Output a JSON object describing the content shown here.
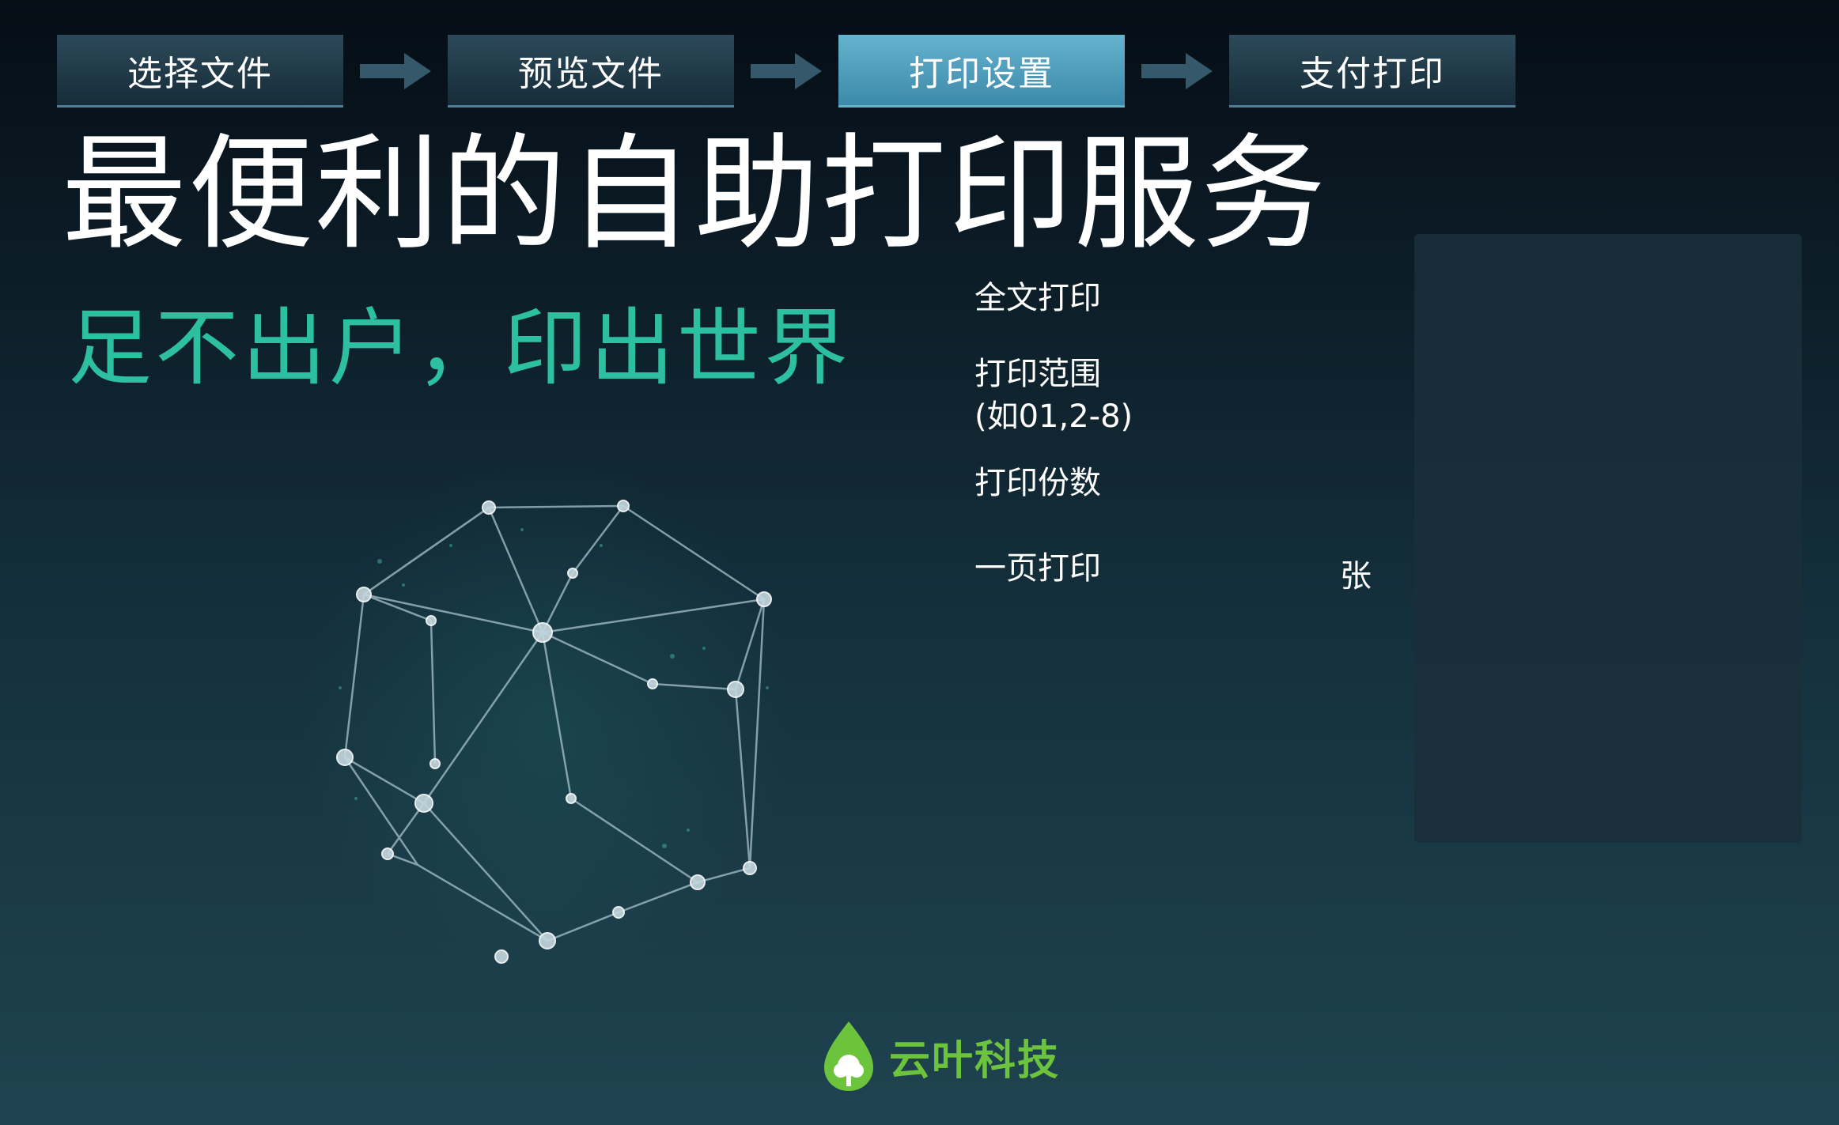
{
  "steps": [
    {
      "label": "选择文件",
      "active": false
    },
    {
      "label": "预览文件",
      "active": false
    },
    {
      "label": "打印设置",
      "active": true
    },
    {
      "label": "支付打印",
      "active": false
    }
  ],
  "headline": "最便利的自助打印服务",
  "slogan": "足不出户，印出世界",
  "settings": {
    "full_print_label": "全文打印",
    "range_label_line1": "打印范围",
    "range_label_line2": "(如01,2-8)",
    "copies_label": "打印份数",
    "per_page_label": "一页打印",
    "per_page_unit": "张"
  },
  "brand": {
    "name": "云叶科技"
  },
  "colors": {
    "accent": "#2cbfa0",
    "active_step": "#4f9fbe",
    "brand_green": "#6cc43c"
  }
}
